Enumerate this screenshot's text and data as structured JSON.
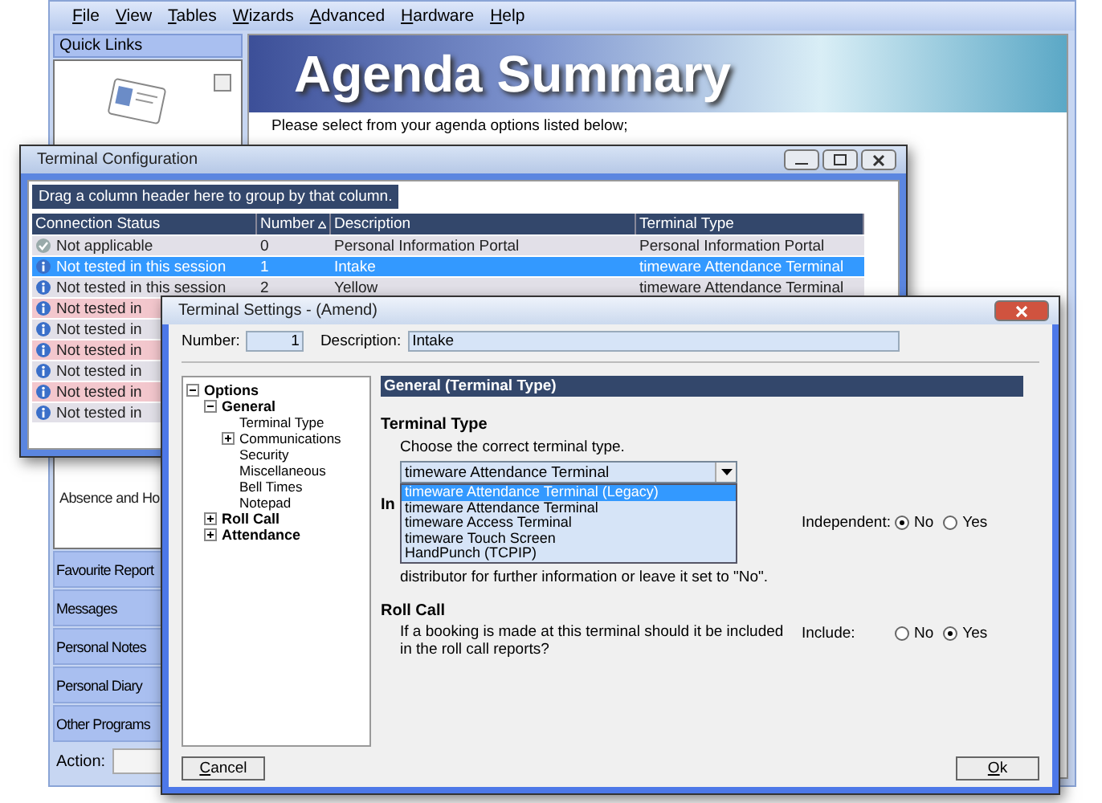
{
  "main_window": {
    "menu": [
      "File",
      "View",
      "Tables",
      "Wizards",
      "Advanced",
      "Hardware",
      "Help"
    ],
    "quick_links": {
      "title": "Quick Links",
      "item_label": "Absence and Ho"
    },
    "nav_items": [
      "Favourite Report",
      "Messages",
      "Personal Notes",
      "Personal Diary",
      "Other Programs"
    ],
    "action_label": "Action:",
    "banner_title": "Agenda Summary",
    "intro": "Please select from your agenda options listed below;"
  },
  "terminal_config": {
    "title": "Terminal Configuration",
    "group_hint": "Drag a column header here to group by that column.",
    "columns": [
      {
        "label": "Connection Status",
        "sorted": false
      },
      {
        "label": "Number",
        "sorted": true
      },
      {
        "label": "Description",
        "sorted": false
      },
      {
        "label": "Terminal Type",
        "sorted": false
      }
    ],
    "rows": [
      {
        "kind": "ok",
        "status": "Not applicable",
        "number": "0",
        "description": "Personal Information Portal",
        "type": "Personal Information Portal",
        "selected": false,
        "flagged": false
      },
      {
        "kind": "info",
        "status": "Not tested in this session",
        "number": "1",
        "description": "Intake",
        "type": "timeware Attendance Terminal",
        "selected": true,
        "flagged": false
      },
      {
        "kind": "info",
        "status": "Not tested in this session",
        "number": "2",
        "description": "Yellow",
        "type": "timeware Attendance Terminal",
        "selected": false,
        "flagged": false
      },
      {
        "kind": "info",
        "status": "Not tested in",
        "selected": false,
        "flagged": true
      },
      {
        "kind": "info",
        "status": "Not tested in",
        "selected": false,
        "flagged": false
      },
      {
        "kind": "info",
        "status": "Not tested in",
        "selected": false,
        "flagged": true
      },
      {
        "kind": "info",
        "status": "Not tested in",
        "selected": false,
        "flagged": false
      },
      {
        "kind": "info",
        "status": "Not tested in",
        "selected": false,
        "flagged": true
      },
      {
        "kind": "info",
        "status": "Not tested in",
        "selected": false,
        "flagged": false
      }
    ]
  },
  "terminal_settings": {
    "title": "Terminal Settings - (Amend)",
    "number_label": "Number:",
    "number": "1",
    "description_label": "Description:",
    "description": "Intake",
    "tree": [
      {
        "label": "Options",
        "expanded": true,
        "children": [
          {
            "label": "General",
            "expanded": true,
            "children": [
              {
                "label": "Terminal Type"
              },
              {
                "label": "Communications",
                "expanded": false
              },
              {
                "label": "Security"
              },
              {
                "label": "Miscellaneous"
              },
              {
                "label": "Bell Times"
              },
              {
                "label": "Notepad"
              }
            ]
          },
          {
            "label": "Roll Call",
            "expanded": false
          },
          {
            "label": "Attendance",
            "expanded": false
          }
        ]
      }
    ],
    "section_title": "General (Terminal Type)",
    "terminal_type": {
      "heading": "Terminal Type",
      "prompt": "Choose the correct terminal type.",
      "value": "timeware Attendance Terminal",
      "options": [
        {
          "label": "timeware Attendance Terminal (Legacy)",
          "highlighted": true
        },
        {
          "label": "timeware Attendance Terminal",
          "highlighted": false
        },
        {
          "label": "timeware Access Terminal",
          "highlighted": false
        },
        {
          "label": "timeware Touch Screen",
          "highlighted": false
        },
        {
          "label": "HandPunch (TCPIP)",
          "highlighted": false
        }
      ]
    },
    "independent": {
      "heading": "In",
      "note": "distributor for further information or leave it set to \"No\".",
      "label": "Independent:",
      "options": [
        {
          "label": "No",
          "selected": true
        },
        {
          "label": "Yes",
          "selected": false
        }
      ]
    },
    "roll_call": {
      "heading": "Roll Call",
      "note": "If a booking is made at this terminal should it be included in the roll call reports?",
      "label": "Include:",
      "options": [
        {
          "label": "No",
          "selected": false
        },
        {
          "label": "Yes",
          "selected": true
        }
      ]
    },
    "buttons": {
      "cancel": "Cancel",
      "ok": "Ok"
    }
  }
}
